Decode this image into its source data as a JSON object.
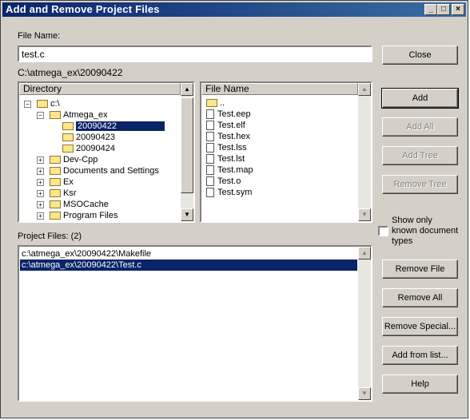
{
  "window": {
    "title": "Add and Remove Project Files",
    "minimize": "_",
    "maximize": "□",
    "close": "×"
  },
  "file_name": {
    "label": "File Name:",
    "value": "test.c"
  },
  "current_path": "C:\\atmega_ex\\20090422",
  "directory": {
    "header": "Directory",
    "items": [
      {
        "label": "c:\\",
        "expander": "−"
      },
      {
        "label": "Atmega_ex",
        "expander": "−"
      },
      {
        "label": "20090422",
        "selected": true
      },
      {
        "label": "20090423"
      },
      {
        "label": "20090424"
      },
      {
        "label": "Dev-Cpp",
        "expander": "+"
      },
      {
        "label": "Documents and Settings",
        "expander": "+"
      },
      {
        "label": "Ex",
        "expander": "+"
      },
      {
        "label": "Ksr",
        "expander": "+"
      },
      {
        "label": "MSOCache",
        "expander": "+"
      },
      {
        "label": "Program Files",
        "expander": "+"
      }
    ]
  },
  "file_list": {
    "header": "File Name",
    "items": [
      "..",
      "Test.eep",
      "Test.elf",
      "Test.hex",
      "Test.lss",
      "Test.lst",
      "Test.map",
      "Test.o",
      "Test.sym"
    ]
  },
  "project_files": {
    "label": "Project Files: (2)",
    "items": [
      {
        "path": "c:\\atmega_ex\\20090422\\Makefile"
      },
      {
        "path": "c:\\atmega_ex\\20090422\\Test.c",
        "selected": true
      }
    ]
  },
  "show_only_known": {
    "label_line1": "Show only",
    "label_line2": "known document",
    "label_line3": "types",
    "checked": false
  },
  "buttons": {
    "close": "Close",
    "add": "Add",
    "add_all": "Add All",
    "add_tree": "Add Tree",
    "remove_tree": "Remove Tree",
    "remove_file": "Remove File",
    "remove_all": "Remove All",
    "remove_special": "Remove Special...",
    "add_from_list": "Add from list...",
    "help": "Help"
  },
  "colors": {
    "titlebar_start": "#0a246a",
    "titlebar_end": "#3a6ea5",
    "selection": "#0a246a",
    "face": "#d4d0c8"
  }
}
